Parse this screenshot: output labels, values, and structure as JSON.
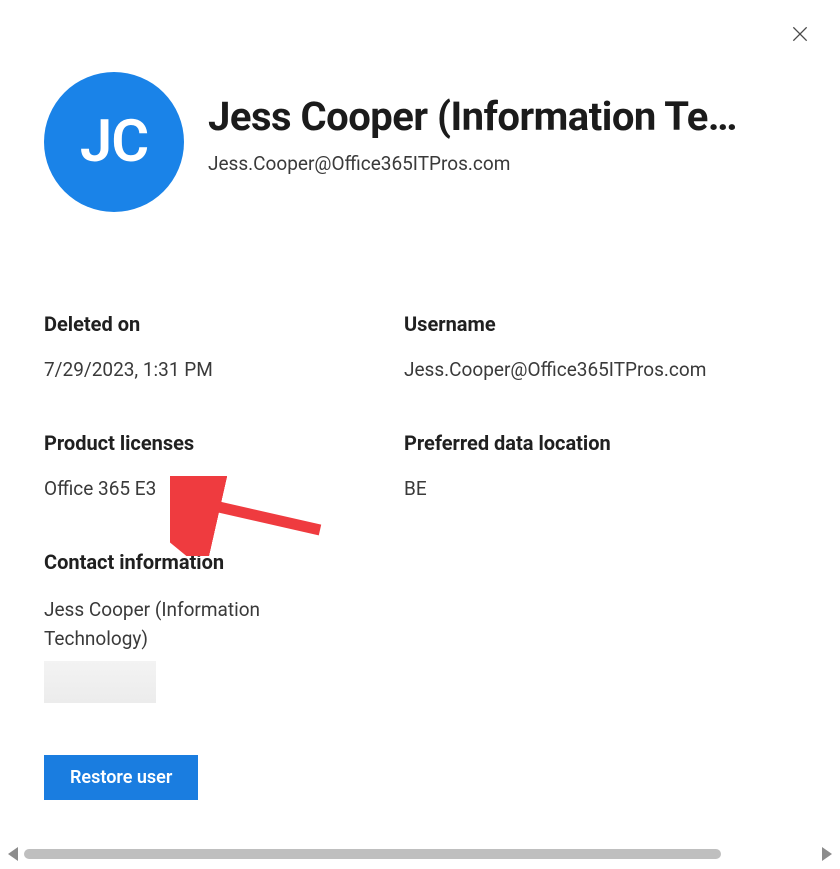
{
  "user": {
    "initials": "JC",
    "display_name": "Jess Cooper (Information Te…",
    "email": "Jess.Cooper@Office365ITPros.com"
  },
  "fields": {
    "deleted_on": {
      "label": "Deleted on",
      "value": "7/29/2023, 1:31 PM"
    },
    "username": {
      "label": "Username",
      "value": "Jess.Cooper@Office365ITPros.com"
    },
    "product_licenses": {
      "label": "Product licenses",
      "value": "Office 365 E3"
    },
    "preferred_data_location": {
      "label": "Preferred data location",
      "value": "BE"
    }
  },
  "contact": {
    "heading": "Contact information",
    "value": "Jess Cooper (Information Technology)"
  },
  "actions": {
    "restore_label": "Restore user"
  },
  "colors": {
    "avatar_bg": "#1a83e8",
    "primary_btn": "#1a7de0",
    "annotation_arrow": "#ef3b3f"
  }
}
